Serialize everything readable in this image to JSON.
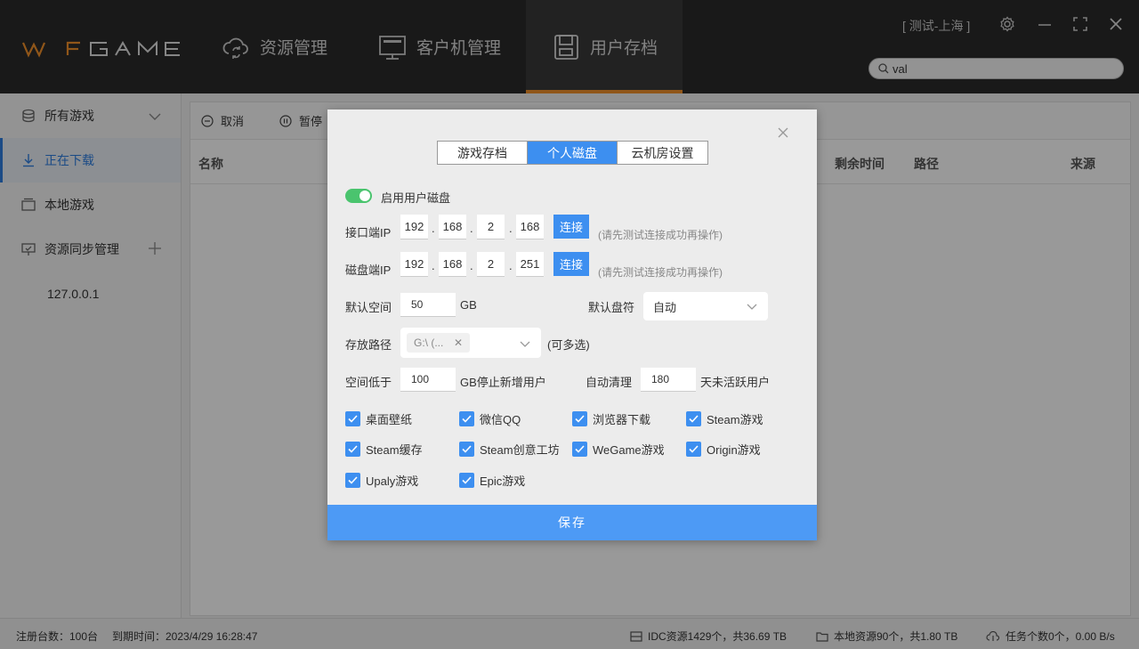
{
  "header": {
    "logo_prefix": "W",
    "logo_mid": "F",
    "logo_rest": "GAME",
    "nav": [
      {
        "label": "资源管理",
        "icon": "cloud-sync-icon"
      },
      {
        "label": "客户机管理",
        "icon": "monitor-icon"
      },
      {
        "label": "用户存档",
        "icon": "save-disk-icon"
      }
    ],
    "region": "[ 测试-上海 ]",
    "search_value": "val"
  },
  "sidebar": {
    "items": [
      {
        "label": "所有游戏",
        "icon": "stack-icon"
      },
      {
        "label": "正在下载",
        "icon": "download-icon"
      },
      {
        "label": "本地游戏",
        "icon": "folder-icon"
      },
      {
        "label": "资源同步管理",
        "icon": "sync-icon"
      }
    ],
    "sub_item": "127.0.0.1"
  },
  "main": {
    "toolbar": {
      "cancel": "取消",
      "pause": "暂停"
    },
    "columns": {
      "name": "名称",
      "remain": "剩余时间",
      "path": "路径",
      "source": "来源"
    }
  },
  "statusbar": {
    "registered": "注册台数：100台",
    "expire": "到期时间：2023/4/29 16:28:47",
    "idc": "IDC资源1429个，共36.69 TB",
    "local": "本地资源90个，共1.80 TB",
    "tasks": "任务个数0个，0.00 B/s"
  },
  "modal": {
    "tabs": [
      "游戏存档",
      "个人磁盘",
      "云机房设置"
    ],
    "enable_label": "启用用户磁盘",
    "iface_ip_label": "接口端IP",
    "iface_ip": [
      "192",
      "168",
      "2",
      "168"
    ],
    "disk_ip_label": "磁盘端IP",
    "disk_ip": [
      "192",
      "168",
      "2",
      "251"
    ],
    "dot": ".",
    "connect_label": "连接",
    "connect_hint": "(请先测试连接成功再操作)",
    "default_space_label": "默认空间",
    "default_space_value": "50",
    "gb_unit": "GB",
    "default_drive_label": "默认盘符",
    "default_drive_value": "自动",
    "path_label": "存放路径",
    "path_tag": "G:\\ (...",
    "path_multi": "(可多选)",
    "space_low_label": "空间低于",
    "space_low_value": "100",
    "space_low_unit": "GB停止新增用户",
    "auto_clean_label": "自动清理",
    "auto_clean_value": "180",
    "auto_clean_unit": "天未活跃用户",
    "checkboxes": [
      "桌面壁纸",
      "微信QQ",
      "浏览器下载",
      "Steam游戏",
      "Steam缓存",
      "Steam创意工坊",
      "WeGame游戏",
      "Origin游戏",
      "Upaly游戏",
      "Epic游戏"
    ],
    "save_label": "保存"
  }
}
